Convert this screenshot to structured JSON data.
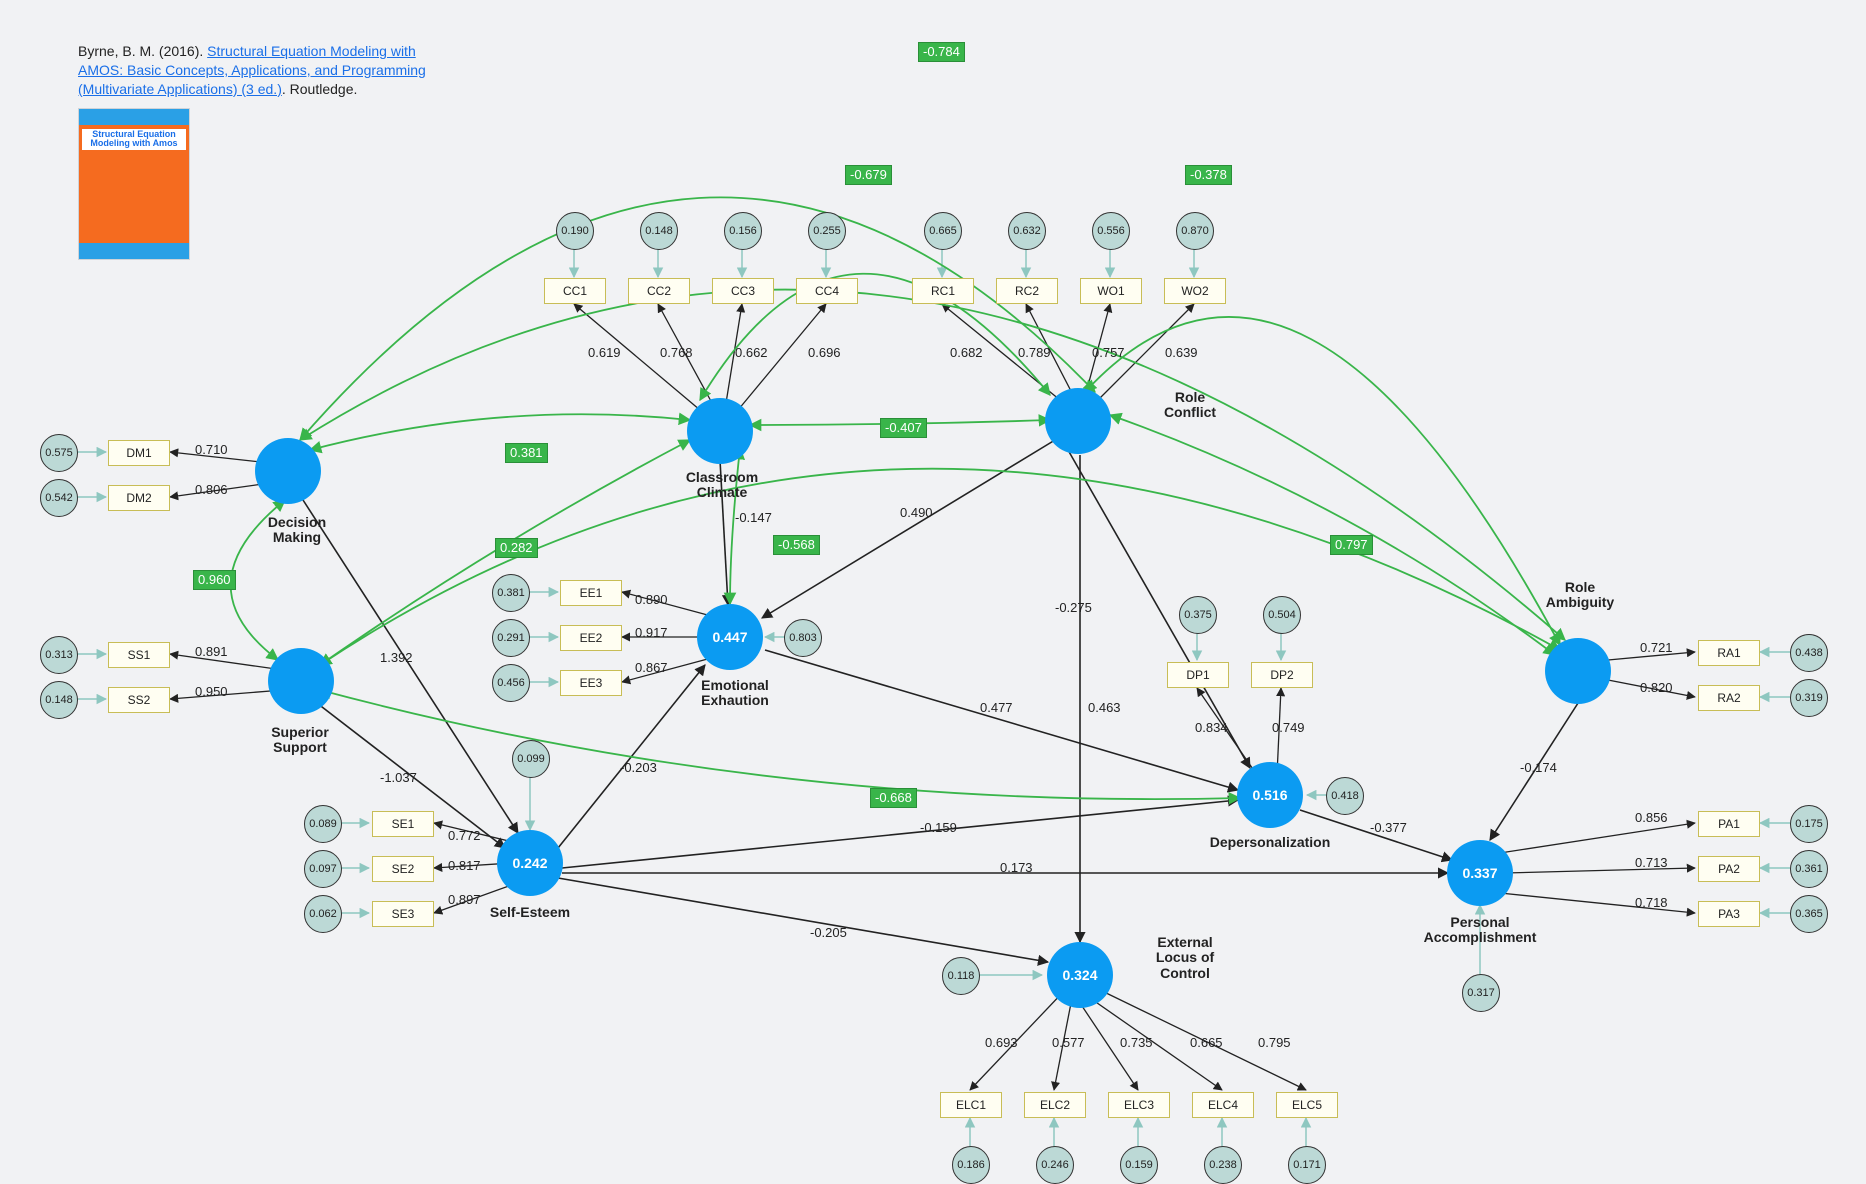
{
  "citation": {
    "prefix": "Byrne, B. M. (2016). ",
    "link": "Structural Equation Modeling with AMOS: Basic Concepts, Applications, and Programming (Multivariate Applications) (3 ed.)",
    "suffix": ". Routledge."
  },
  "book": {
    "title": "Structural Equation Modeling with Amos"
  },
  "latents": {
    "DecisionMaking": {
      "label": "Decision Making",
      "value": ""
    },
    "SuperiorSupport": {
      "label": "Superior Support",
      "value": ""
    },
    "ClassroomClimate": {
      "label": "Classroom Climate",
      "value": ""
    },
    "RoleConflict": {
      "label": "Role Conflict",
      "value": ""
    },
    "RoleAmbiguity": {
      "label": "Role Ambiguity",
      "value": ""
    },
    "SelfEsteem": {
      "label": "Self-Esteem",
      "value": "0.242"
    },
    "EmotionalExhaustion": {
      "label": "Emotional Exhaution",
      "value": "0.447"
    },
    "Depersonalization": {
      "label": "Depersonalization",
      "value": "0.516"
    },
    "ExternalLocus": {
      "label": "External Locus of Control",
      "value": "0.324"
    },
    "PersonalAccomplishment": {
      "label": "Personal Accomplishment",
      "value": "0.337"
    }
  },
  "indicators": {
    "DM1": {
      "err": "0.575"
    },
    "DM2": {
      "err": "0.542"
    },
    "SS1": {
      "err": "0.313"
    },
    "SS2": {
      "err": "0.148"
    },
    "CC1": {
      "err": "0.190"
    },
    "CC2": {
      "err": "0.148"
    },
    "CC3": {
      "err": "0.156"
    },
    "CC4": {
      "err": "0.255"
    },
    "RC1": {
      "err": "0.665"
    },
    "RC2": {
      "err": "0.632"
    },
    "WO1": {
      "err": "0.556"
    },
    "WO2": {
      "err": "0.870"
    },
    "RA1": {
      "err": "0.438"
    },
    "RA2": {
      "err": "0.319"
    },
    "SE1": {
      "err": "0.089"
    },
    "SE2": {
      "err": "0.097"
    },
    "SE3": {
      "err": "0.062"
    },
    "EE1": {
      "err": "0.381"
    },
    "EE2": {
      "err": "0.291"
    },
    "EE3": {
      "err": "0.456"
    },
    "DP1": {
      "err": "0.375"
    },
    "DP2": {
      "err": "0.504"
    },
    "ELC1": {
      "err": "0.186"
    },
    "ELC2": {
      "err": "0.246"
    },
    "ELC3": {
      "err": "0.159"
    },
    "ELC4": {
      "err": "0.238"
    },
    "ELC5": {
      "err": "0.171"
    },
    "PA1": {
      "err": "0.175"
    },
    "PA2": {
      "err": "0.361"
    },
    "PA3": {
      "err": "0.365"
    }
  },
  "loadings": {
    "DM1": "0.710",
    "DM2": "0.806",
    "SS1": "0.891",
    "SS2": "0.950",
    "CC1": "0.619",
    "CC2": "0.768",
    "CC3": "0.662",
    "CC4": "0.696",
    "RC1": "0.682",
    "RC2": "0.789",
    "WO1": "0.757",
    "WO2": "0.639",
    "RA1": "0.721",
    "RA2": "0.820",
    "SE1": "0.772",
    "SE2": "0.817",
    "SE3": "0.897",
    "EE1": "0.890",
    "EE2": "0.917",
    "EE3": "0.867",
    "DP1": "0.834",
    "DP2": "0.749",
    "ELC1": "0.693",
    "ELC2": "0.577",
    "ELC3": "0.735",
    "ELC4": "0.665",
    "ELC5": "0.795",
    "PA1": "0.856",
    "PA2": "0.713",
    "PA3": "0.718"
  },
  "paths": {
    "DM_SE": "1.392",
    "SS_SE": "-1.037",
    "CC_EE": "-0.147",
    "RC_EE": "0.490",
    "RC_DP": "-0.275",
    "RC_ELC": "0.463",
    "SE_EE": "-0.203",
    "SE_ELC": "-0.205",
    "SE_DP": "-0.159",
    "SE_PA": "0.173",
    "EE_DP": "0.477",
    "DP_PA": "-0.377",
    "RA_PA": "-0.174"
  },
  "covariances": {
    "DM_SS": "0.960",
    "DM_CC": "0.381",
    "SS_CC": "0.282",
    "CC_RC": "-0.407",
    "CC_EEarrow": "-0.568",
    "CC_RCtop": "-0.679",
    "RC_RA": "-0.378",
    "DM_RC": "-0.784",
    "RC_RAmid": "0.797",
    "SS_DP": "-0.668"
  },
  "disturbances": {
    "EE": "0.803",
    "SE": "0.099",
    "DP": "0.418",
    "ELC": "0.118",
    "PA": "0.317"
  }
}
